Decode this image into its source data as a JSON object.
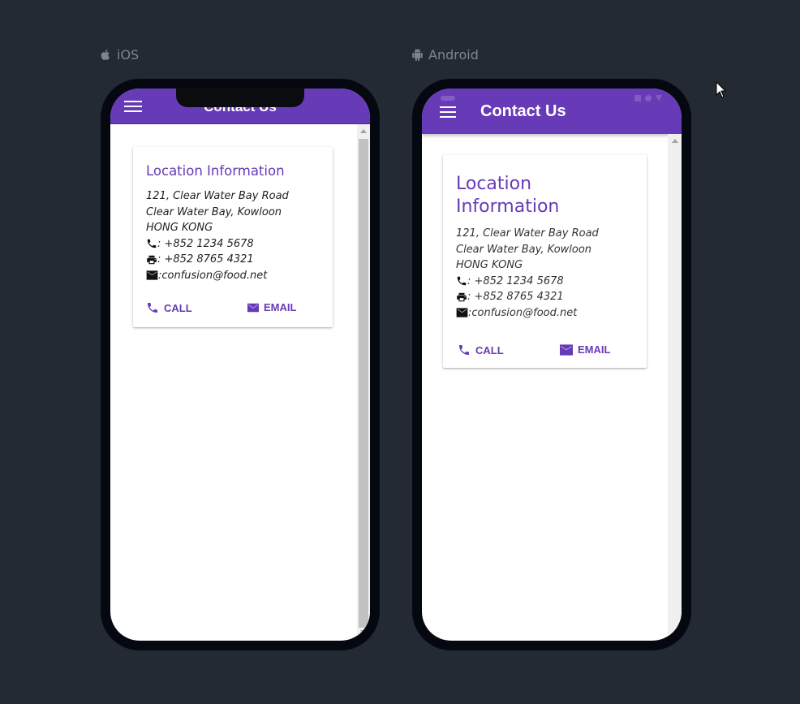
{
  "platforms": {
    "ios": {
      "label": "iOS",
      "icon": "apple-icon",
      "toolbar_title": "Contact Us",
      "menu_icon": "hamburger-menu-icon"
    },
    "android": {
      "label": "Android",
      "icon": "android-icon",
      "toolbar_title": "Contact Us",
      "menu_icon": "hamburger-menu-icon"
    }
  },
  "card": {
    "title": "Location Information",
    "title_line1": "Location",
    "title_line2": "Information",
    "address_line1": "121, Clear Water Bay Road",
    "address_line2": "Clear Water Bay, Kowloon",
    "address_line3": "HONG KONG",
    "phone": ": +852 1234 5678",
    "fax": ": +852 8765 4321",
    "email": ":confusion@food.net",
    "call_label": "CALL",
    "email_label": "EMAIL"
  },
  "colors": {
    "primary": "#673ab7",
    "background": "#242a33",
    "phone_frame": "#050810"
  }
}
